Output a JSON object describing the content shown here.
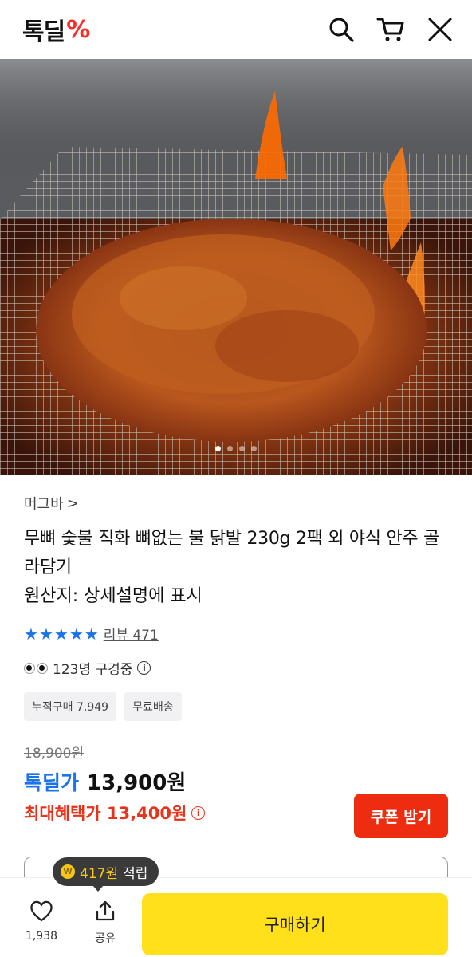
{
  "header": {
    "logo_text": "톡딜",
    "logo_mark": "%",
    "icons": [
      "search-icon",
      "cart-icon",
      "close-icon"
    ]
  },
  "hero": {
    "image_desc": "grilled spicy chicken feet on charcoal grill",
    "slide_count": 4,
    "active_slide": 0
  },
  "product": {
    "brand": "머그바",
    "brand_chevron": ">",
    "title": "무뼈 숯불 직화 뼈없는 불 닭발 230g 2팩 외 야식 안주 골라담기",
    "origin": "원산지: 상세설명에 표시",
    "review_label": "리뷰 471",
    "watching": "123명 구경중",
    "chips": [
      "누적구매 7,949",
      "무료배송"
    ],
    "price_original": "18,900원",
    "price_label": "톡딜가",
    "price_value": "13,900원",
    "benefit_text": "최대혜택가 13,400원",
    "coupon_button": "쿠폰 받기"
  },
  "bottom": {
    "points_amount": "417원",
    "points_label": "적립",
    "coin_glyph": "W",
    "like_count": "1,938",
    "share_label": "공유",
    "buy_label": "구매하기"
  },
  "colors": {
    "accent_blue": "#1a73e8",
    "sale_red": "#e8321a",
    "coupon_red": "#ee2d10",
    "buy_yellow": "#ffe01a"
  }
}
